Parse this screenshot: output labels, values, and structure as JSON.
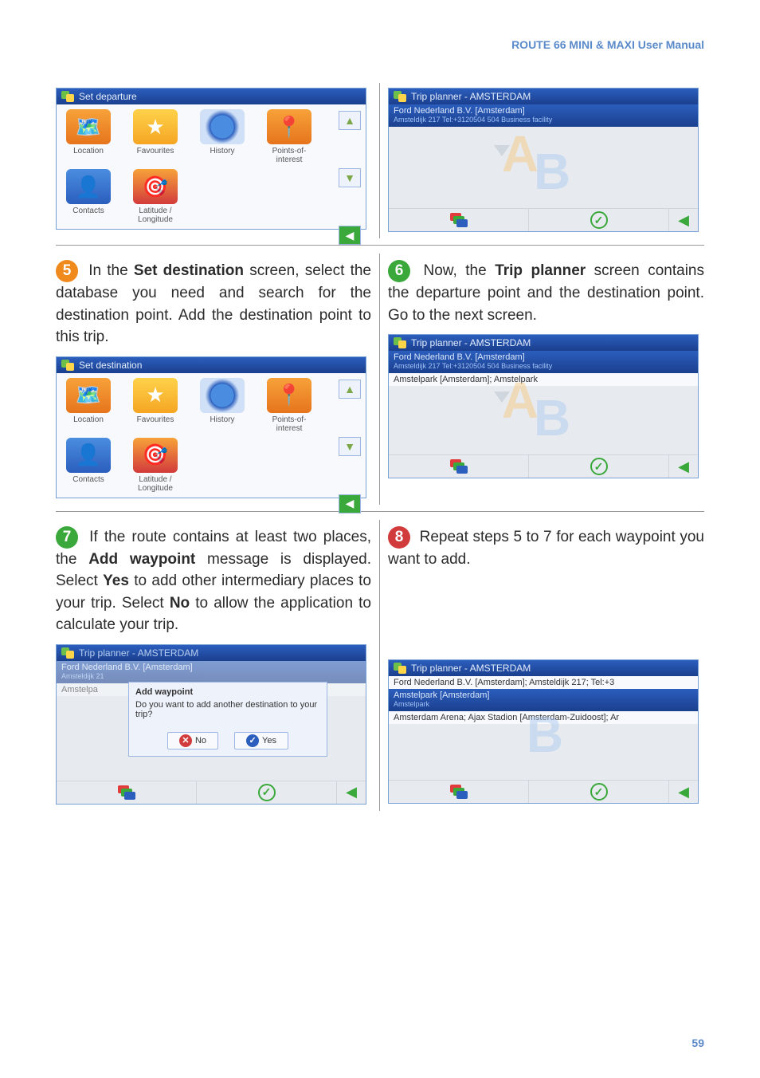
{
  "header": "ROUTE 66 MINI & MAXI User Manual",
  "page_number": "59",
  "icons": {
    "location": "Location",
    "favourites": "Favourites",
    "history": "History",
    "poi": "Points-of-interest",
    "contacts": "Contacts",
    "latlon": "Latitude /\nLongitude"
  },
  "screens": {
    "set_departure_title": "Set departure",
    "set_destination_title": "Set destination",
    "trip_planner_title": "Trip planner - AMSTERDAM",
    "entry1_main": "Ford Nederland B.V. [Amsterdam]",
    "entry1_sub": "Amsteldijk 217 Tel:+3120504 504 Business facility",
    "entry2_plain": "Amstelpark [Amsterdam]; Amstelpark",
    "entry3_main": "Ford Nederland B.V. [Amsterdam]; Amsteldijk 217; Tel:+3",
    "entry4_sel_main": "Amstelpark [Amsterdam]",
    "entry4_sel_sub": "Amstelpark",
    "entry5_plain": "Amsterdam Arena; Ajax Stadion [Amsterdam-Zuidoost]; Ar"
  },
  "dialog": {
    "title": "Add waypoint",
    "body": "Do you want to add another destination to your trip?",
    "no": "No",
    "yes": "Yes",
    "behind_entry1": "Ford Nederland B.V. [Amsterdam]",
    "behind_entry1_sub": "Amsteldijk 21",
    "behind_entry2": "Amstelpa"
  },
  "steps": {
    "s5_pre": " In the ",
    "s5_bold": "Set destination",
    "s5_post": " screen, select the database you need and search for the destination point. Add the destination point to this trip.",
    "s6_pre": " Now, the ",
    "s6_bold": "Trip planner",
    "s6_post": " screen contains the departure point and the destination point. Go to the next screen.",
    "s7_pre": " If the route contains at least two places, the ",
    "s7_bold1": "Add waypoint",
    "s7_mid": " message is displayed. Select ",
    "s7_bold2": "Yes",
    "s7_mid2": " to add other intermediary places to your trip. Select ",
    "s7_bold3": "No",
    "s7_post": " to allow the application to calculate your trip.",
    "s8": " Repeat steps 5 to 7 for each waypoint you want to add."
  }
}
